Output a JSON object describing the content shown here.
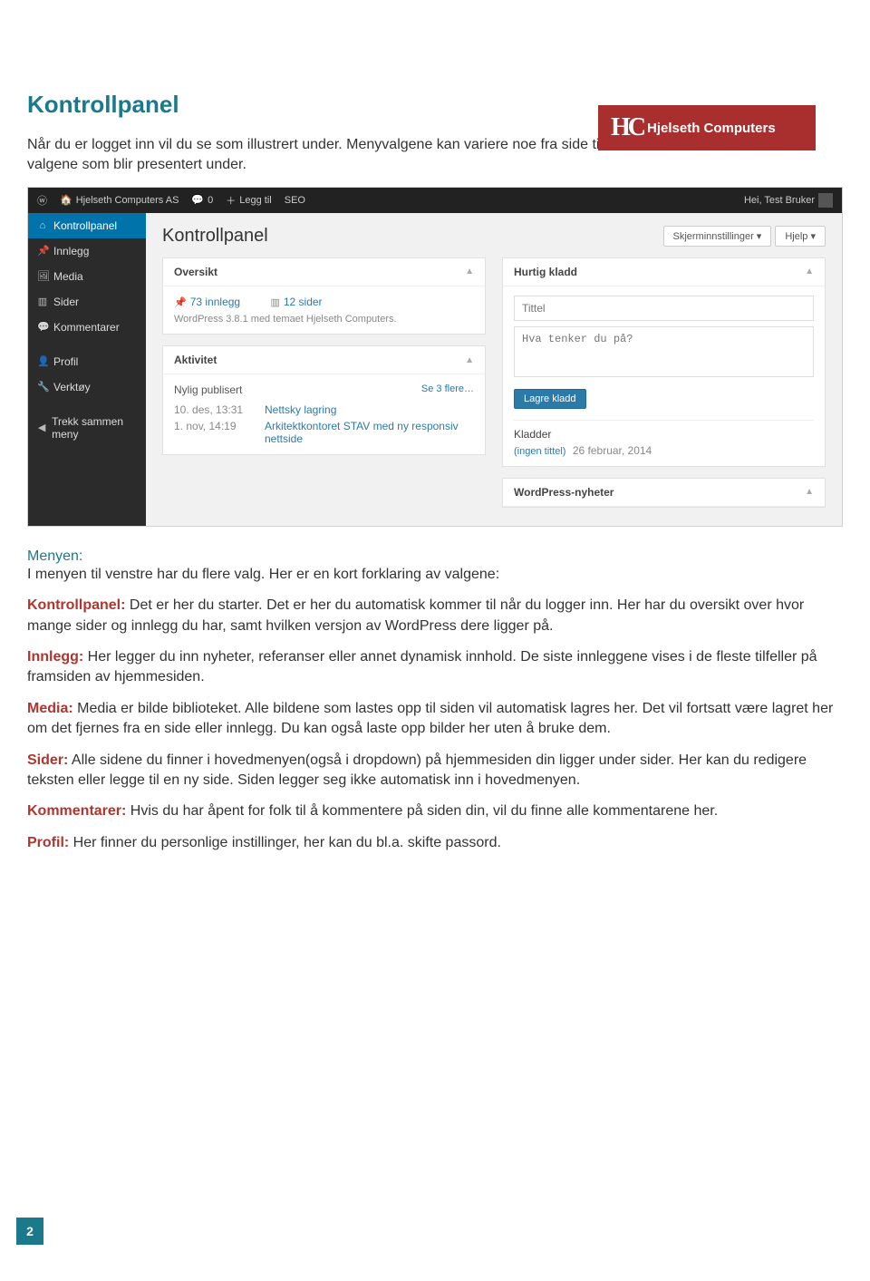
{
  "badge": {
    "logo": "HC",
    "text": "Hjelseth Computers"
  },
  "doc": {
    "title": "Kontrollpanel",
    "intro": "Når du er logget inn vil du se som illustrert under. Menyvalgene kan variere noe fra side til side, men vil alltid inneholde valgene som blir presentert under.",
    "menyen_label": "Menyen:",
    "menyen_intro": "I menyen til venstre har du flere valg. Her er en kort forklaring av valgene:",
    "items": [
      {
        "term": "Kontrollpanel:",
        "text": " Det er her du starter. Det er her du automatisk kommer til når du logger inn. Her har du oversikt over hvor mange sider og innlegg du har, samt hvilken versjon av WordPress dere ligger på."
      },
      {
        "term": "Innlegg:",
        "text": " Her legger du inn nyheter, referanser eller annet dynamisk innhold. De siste innleggene vises i de fleste tilfeller på framsiden av hjemmesiden."
      },
      {
        "term": "Media:",
        "text": " Media er bilde biblioteket. Alle bildene som lastes opp til siden vil automatisk lagres her. Det vil fortsatt være lagret her om det fjernes fra en side eller innlegg. Du kan også laste opp bilder her uten å bruke dem."
      },
      {
        "term": "Sider:",
        "text": " Alle sidene du finner i hovedmenyen(også i dropdown) på hjemmesiden din ligger under sider. Her kan du redigere teksten eller legge til en ny side. Siden legger seg ikke automatisk inn i hovedmenyen."
      },
      {
        "term": "Kommentarer:",
        "text": " Hvis du har åpent for folk til å kommentere på siden din, vil du finne alle kommentarene her."
      },
      {
        "term": "Profil:",
        "text": " Her finner du personlige instillinger, her kan du bl.a. skifte passord."
      }
    ],
    "page_number": "2"
  },
  "wp": {
    "topbar": {
      "site": "Hjelseth Computers AS",
      "comments": "0",
      "add": "Legg til",
      "seo": "SEO",
      "greeting": "Hei, Test Bruker"
    },
    "sidebar": {
      "items": [
        {
          "icon": "⌂",
          "label": "Kontrollpanel",
          "active": true
        },
        {
          "icon": "📌",
          "label": "Innlegg"
        },
        {
          "icon": "🖼",
          "label": "Media"
        },
        {
          "icon": "▥",
          "label": "Sider"
        },
        {
          "icon": "💬",
          "label": "Kommentarer"
        },
        {
          "icon": "👤",
          "label": "Profil"
        },
        {
          "icon": "🔧",
          "label": "Verktøy"
        },
        {
          "icon": "◀",
          "label": "Trekk sammen meny"
        }
      ]
    },
    "content": {
      "heading": "Kontrollpanel",
      "tabs": {
        "screen": "Skjerminnstillinger ▾",
        "help": "Hjelp ▾"
      },
      "oversikt": {
        "title": "Oversikt",
        "posts": "73 innlegg",
        "pages": "12 sider",
        "version": "WordPress 3.8.1 med temaet Hjelseth Computers."
      },
      "aktivitet": {
        "title": "Aktivitet",
        "recent_label": "Nylig publisert",
        "see_more": "Se 3 flere…",
        "rows": [
          {
            "time": "10. des, 13:31",
            "title": "Nettsky lagring"
          },
          {
            "time": "1. nov, 14:19",
            "title": "Arkitektkontoret STAV med ny responsiv nettside"
          }
        ]
      },
      "hurtig": {
        "title": "Hurtig kladd",
        "title_ph": "Tittel",
        "body_ph": "Hva tenker du på?",
        "button": "Lagre kladd",
        "drafts_label": "Kladder",
        "draft_row": "(ingen tittel)",
        "draft_date": "26 februar, 2014"
      },
      "news": {
        "title": "WordPress-nyheter"
      }
    }
  }
}
